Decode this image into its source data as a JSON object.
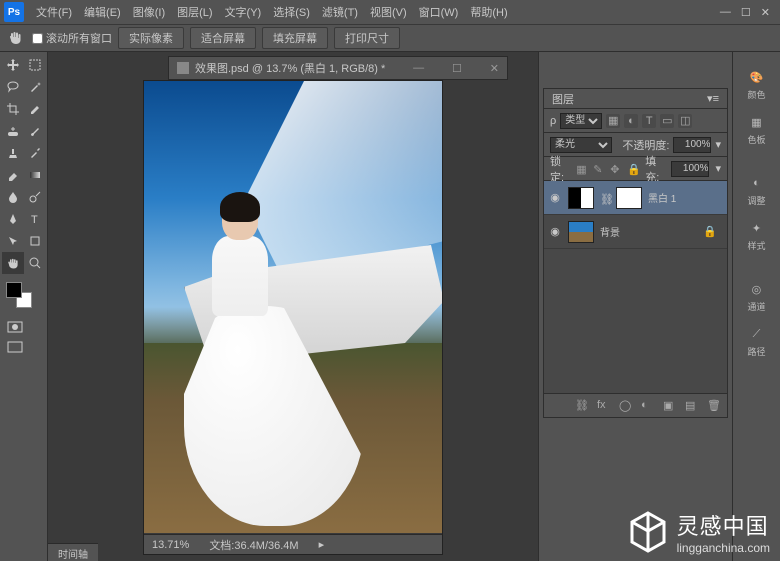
{
  "menu": {
    "file": "文件(F)",
    "edit": "编辑(E)",
    "image": "图像(I)",
    "layer": "图层(L)",
    "type": "文字(Y)",
    "select": "选择(S)",
    "filter": "滤镜(T)",
    "view": "视图(V)",
    "window": "窗口(W)",
    "help": "帮助(H)"
  },
  "options": {
    "scroll_all": "滚动所有窗口",
    "actual_pixels": "实际像素",
    "fit_screen": "适合屏幕",
    "fill_screen": "填充屏幕",
    "print_size": "打印尺寸"
  },
  "document": {
    "tab_title": "效果图.psd @ 13.7% (黑白 1, RGB/8) *",
    "zoom": "13.71%",
    "doc_info": "文档:36.4M/36.4M"
  },
  "panels": {
    "layers_title": "图层",
    "filter_kind": "类型",
    "blend_mode": "柔光",
    "opacity_label": "不透明度:",
    "opacity_value": "100%",
    "lock_label": "锁定:",
    "fill_label": "填充:",
    "fill_value": "100%"
  },
  "layers": [
    {
      "name": "黑白 1",
      "selected": true,
      "locked": false,
      "type": "adjustment"
    },
    {
      "name": "背景",
      "selected": false,
      "locked": true,
      "type": "image"
    }
  ],
  "strip": {
    "color": "颜色",
    "swatches": "色板",
    "adjust": "调整",
    "styles": "样式",
    "channels": "通道",
    "paths": "路径"
  },
  "timeline": {
    "label": "时间轴"
  },
  "watermark": {
    "title": "灵感中国",
    "domain": "lingganchina.com"
  }
}
